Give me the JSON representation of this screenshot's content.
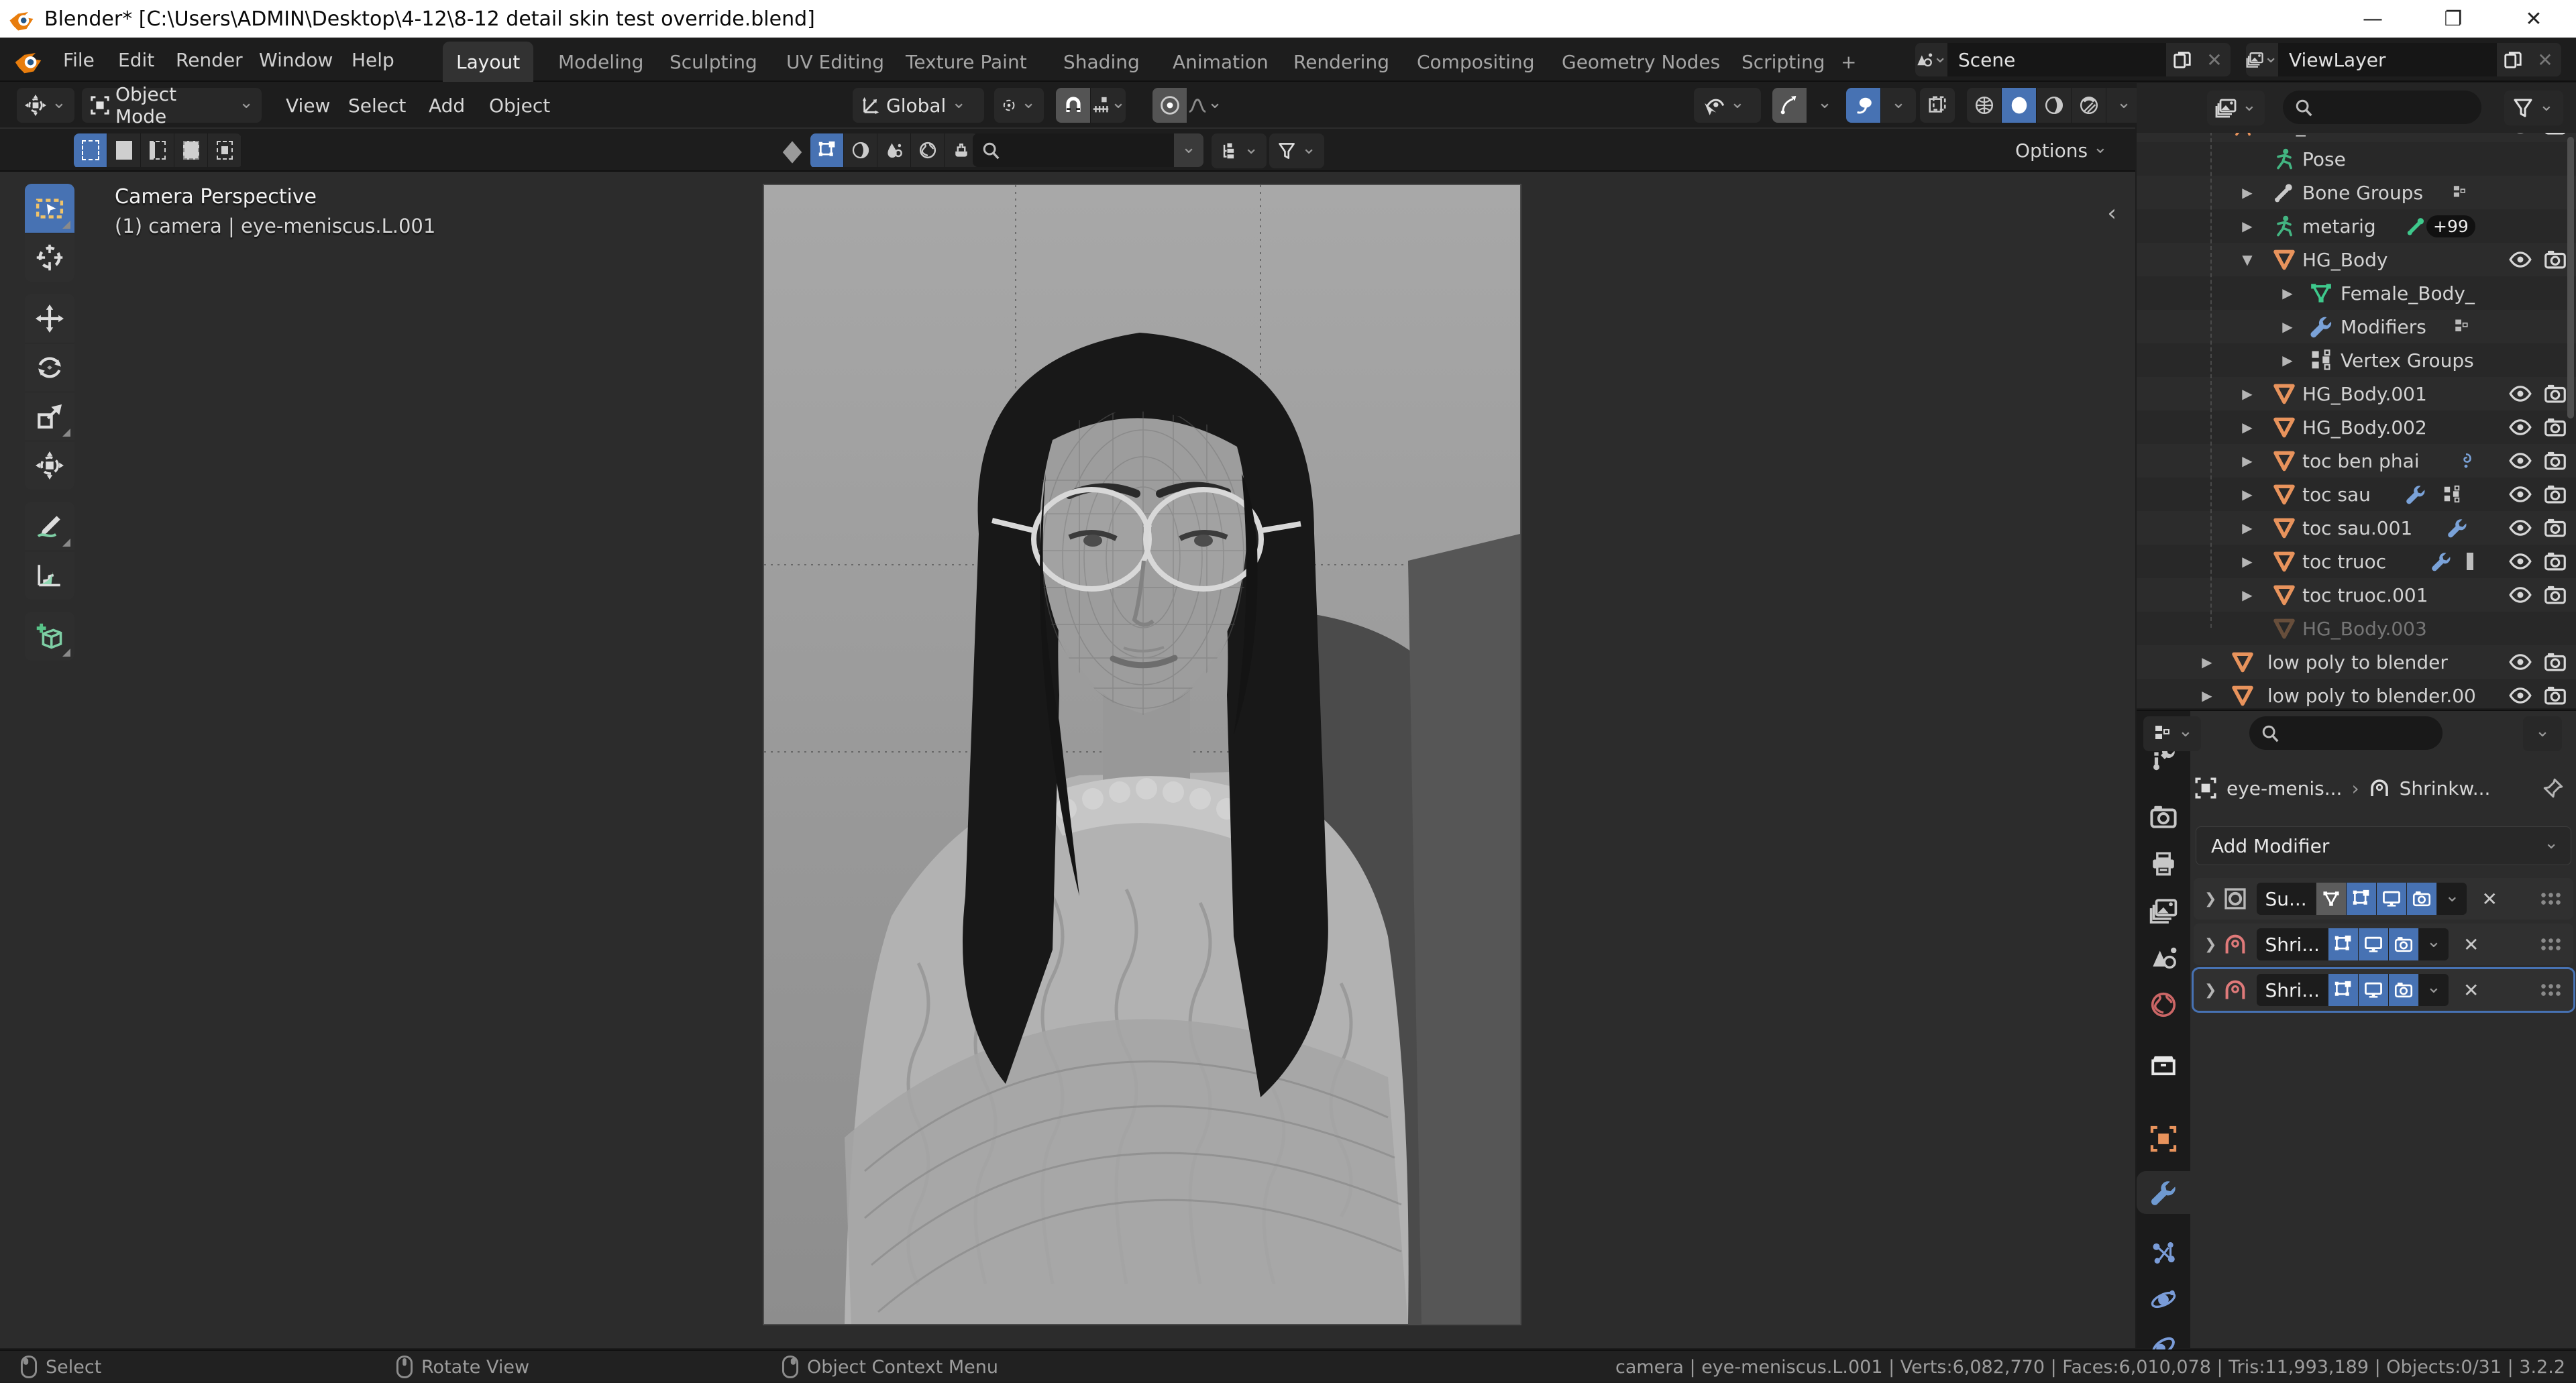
{
  "window": {
    "title": "Blender* [C:\\Users\\ADMIN\\Desktop\\4-12\\8-12 detail skin test override.blend]"
  },
  "topbar": {
    "menus": [
      "File",
      "Edit",
      "Render",
      "Window",
      "Help"
    ],
    "workspaces": [
      "Layout",
      "Modeling",
      "Sculpting",
      "UV Editing",
      "Texture Paint",
      "Shading",
      "Animation",
      "Rendering",
      "Compositing",
      "Geometry Nodes",
      "Scripting"
    ],
    "active_workspace": "Layout",
    "add_workspace": "+",
    "scene": "Scene",
    "view_layer": "ViewLayer"
  },
  "viewport": {
    "header": {
      "mode": "Object Mode",
      "menus": [
        "View",
        "Select",
        "Add",
        "Object"
      ],
      "orientation": "Global"
    },
    "tool_settings": {
      "options": "Options"
    },
    "overlay": {
      "line1": "Camera Perspective",
      "line2": "(1) camera | eye-meniscus.L.001"
    },
    "tools": [
      "select-box",
      "cursor",
      "move",
      "rotate",
      "scale",
      "transform",
      "annotate",
      "measure",
      "add-cube"
    ]
  },
  "outliner": {
    "items": [
      {
        "label": "HG_Chandra",
        "caret": "▼"
      },
      {
        "label": "Pose",
        "caret": ""
      },
      {
        "label": "Bone Groups",
        "caret": "▶"
      },
      {
        "label": "metarig",
        "caret": "▶",
        "badge": "+99"
      },
      {
        "label": "HG_Body",
        "caret": "▼"
      },
      {
        "label": "Female_Body_",
        "caret": "▶"
      },
      {
        "label": "Modifiers",
        "caret": "▶"
      },
      {
        "label": "Vertex Groups",
        "caret": "▶"
      },
      {
        "label": "HG_Body.001",
        "caret": "▶"
      },
      {
        "label": "HG_Body.002",
        "caret": "▶"
      },
      {
        "label": "toc ben phai",
        "caret": "▶"
      },
      {
        "label": "toc sau",
        "caret": "▶"
      },
      {
        "label": "toc sau.001",
        "caret": "▶"
      },
      {
        "label": "toc truoc",
        "caret": "▶"
      },
      {
        "label": "toc truoc.001",
        "caret": "▶"
      },
      {
        "label": "HG_Body.003",
        "caret": ""
      },
      {
        "label": "low poly to blender",
        "caret": "▶"
      },
      {
        "label": "low poly to blender.00",
        "caret": "▶"
      }
    ]
  },
  "properties": {
    "breadcrumb": {
      "object": "eye-menis...",
      "separator": "›",
      "modifier": "Shrinkw..."
    },
    "add_modifier": "Add Modifier",
    "modifiers": [
      {
        "name": "Su...",
        "type": "subdivision-surface"
      },
      {
        "name": "Shri...",
        "type": "shrinkwrap"
      },
      {
        "name": "Shri...",
        "type": "shrinkwrap"
      }
    ]
  },
  "statusbar": {
    "hints": [
      {
        "label": "Select"
      },
      {
        "label": "Rotate View"
      },
      {
        "label": "Object Context Menu"
      }
    ],
    "stats": "camera | eye-meniscus.L.001 | Verts:6,082,770 | Faces:6,010,078 | Tris:11,993,189 | Objects:0/31 | 3.2.2"
  },
  "colors": {
    "accent": "#4772b3",
    "mesh_orange": "#e8935c",
    "armature_green": "#43b582",
    "modifier_blue": "#7aa2d8",
    "shrinkwrap_red": "#e07a7a",
    "world_red": "#cc6666"
  }
}
